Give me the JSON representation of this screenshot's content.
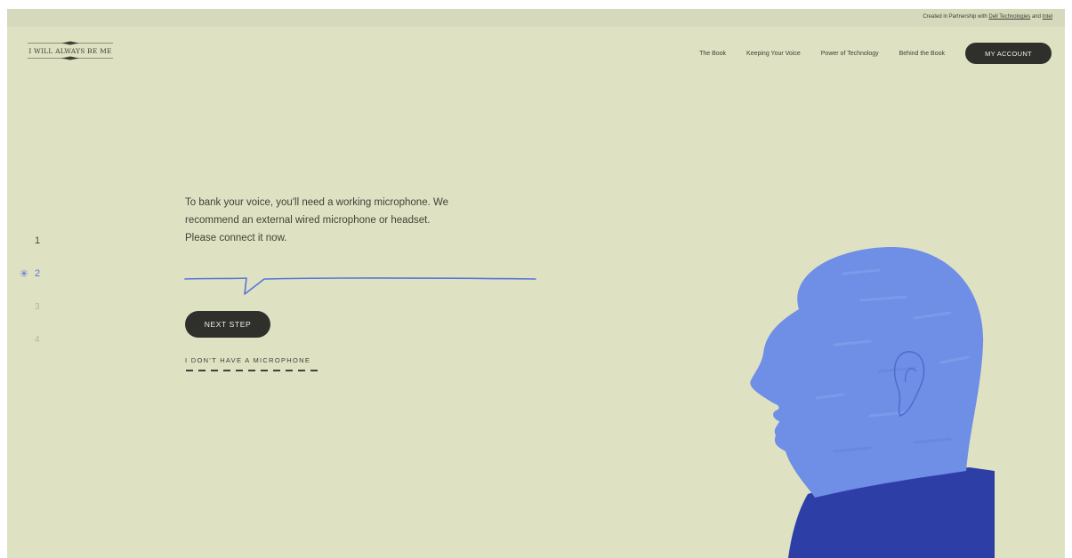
{
  "partner_bar": {
    "prefix": "Created in Partnership with",
    "link1": "Dell Technologies",
    "and": "and",
    "link2": "Intel"
  },
  "logo": {
    "text": "I WILL ALWAYS BE ME"
  },
  "nav": {
    "items": [
      "The Book",
      "Keeping Your Voice",
      "Power of Technology",
      "Behind the Book"
    ],
    "account_label": "MY ACCOUNT"
  },
  "steps": {
    "items": [
      "1",
      "2",
      "3",
      "4"
    ],
    "active_mark": "✳"
  },
  "prompt": {
    "line1": "To bank your voice, you'll need a working microphone. We",
    "line2": "recommend an external wired microphone or headset.",
    "line3": "Please connect it now."
  },
  "actions": {
    "next_label": "NEXT STEP",
    "no_mic_label": "I DON'T HAVE A MICROPHONE"
  },
  "colors": {
    "background": "#dfe2c2",
    "accent": "#5476d8",
    "button": "#2f302b",
    "head": "#6f8ee6",
    "shirt": "#2d3ea6"
  }
}
